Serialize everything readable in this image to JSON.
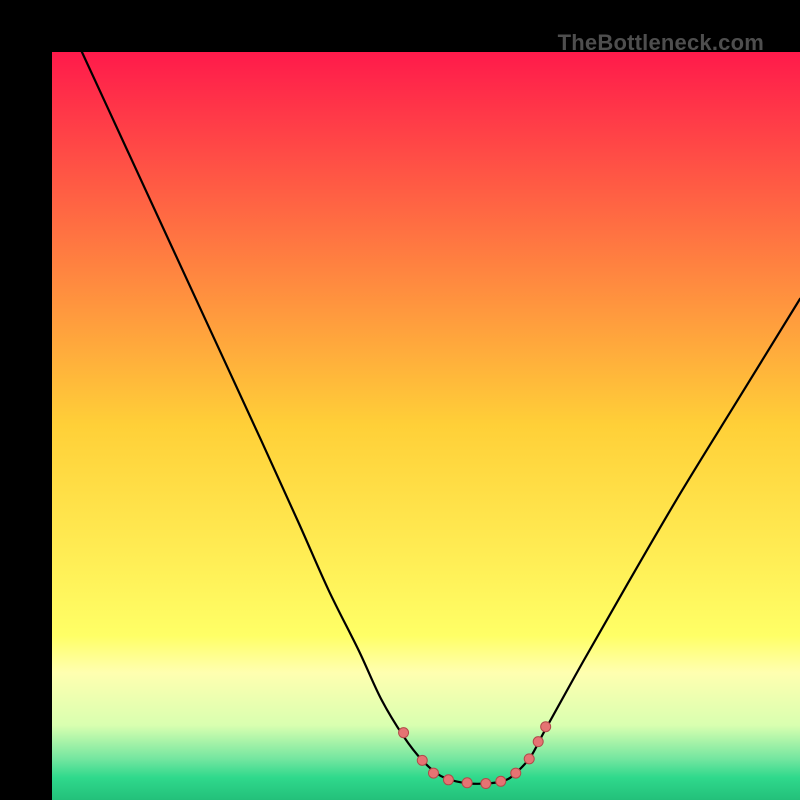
{
  "watermark": "TheBottleneck.com",
  "chart_data": {
    "type": "line",
    "title": "",
    "xlabel": "",
    "ylabel": "",
    "xlim": [
      0,
      100
    ],
    "ylim": [
      0,
      100
    ],
    "grid": false,
    "legend": false,
    "background_gradient": {
      "stops": [
        {
          "offset": 0.0,
          "color": "#ff1a4b"
        },
        {
          "offset": 0.5,
          "color": "#ffd038"
        },
        {
          "offset": 0.78,
          "color": "#ffff66"
        },
        {
          "offset": 0.83,
          "color": "#ffffb0"
        },
        {
          "offset": 0.9,
          "color": "#d9ffb0"
        },
        {
          "offset": 0.945,
          "color": "#74e6a0"
        },
        {
          "offset": 0.97,
          "color": "#2fd98c"
        },
        {
          "offset": 1.0,
          "color": "#23c07a"
        }
      ]
    },
    "series": [
      {
        "name": "curve",
        "color": "#000000",
        "stroke_width": 2.2,
        "x": [
          4,
          10,
          16,
          22,
          28,
          33,
          37,
          41,
          44,
          47,
          49.5,
          52,
          55,
          58,
          60.5,
          62,
          64,
          66,
          71,
          77,
          84,
          92,
          100
        ],
        "y": [
          100,
          87,
          74,
          61,
          48,
          37,
          28,
          20,
          13.5,
          8.5,
          5.3,
          3.2,
          2.3,
          2.2,
          2.6,
          3.6,
          5.8,
          9.5,
          18.5,
          29,
          41,
          54,
          67
        ]
      }
    ],
    "markers": {
      "color": "#e57373",
      "stroke": "#b24a4a",
      "points": [
        {
          "x": 47.0,
          "y": 9.0,
          "r": 5
        },
        {
          "x": 49.5,
          "y": 5.3,
          "r": 5
        },
        {
          "x": 51.0,
          "y": 3.6,
          "r": 5
        },
        {
          "x": 53.0,
          "y": 2.7,
          "r": 5
        },
        {
          "x": 55.5,
          "y": 2.3,
          "r": 5
        },
        {
          "x": 58.0,
          "y": 2.2,
          "r": 5
        },
        {
          "x": 60.0,
          "y": 2.5,
          "r": 5
        },
        {
          "x": 62.0,
          "y": 3.6,
          "r": 5
        },
        {
          "x": 63.8,
          "y": 5.5,
          "r": 5
        },
        {
          "x": 65.0,
          "y": 7.8,
          "r": 5
        },
        {
          "x": 66.0,
          "y": 9.8,
          "r": 5
        }
      ]
    }
  }
}
